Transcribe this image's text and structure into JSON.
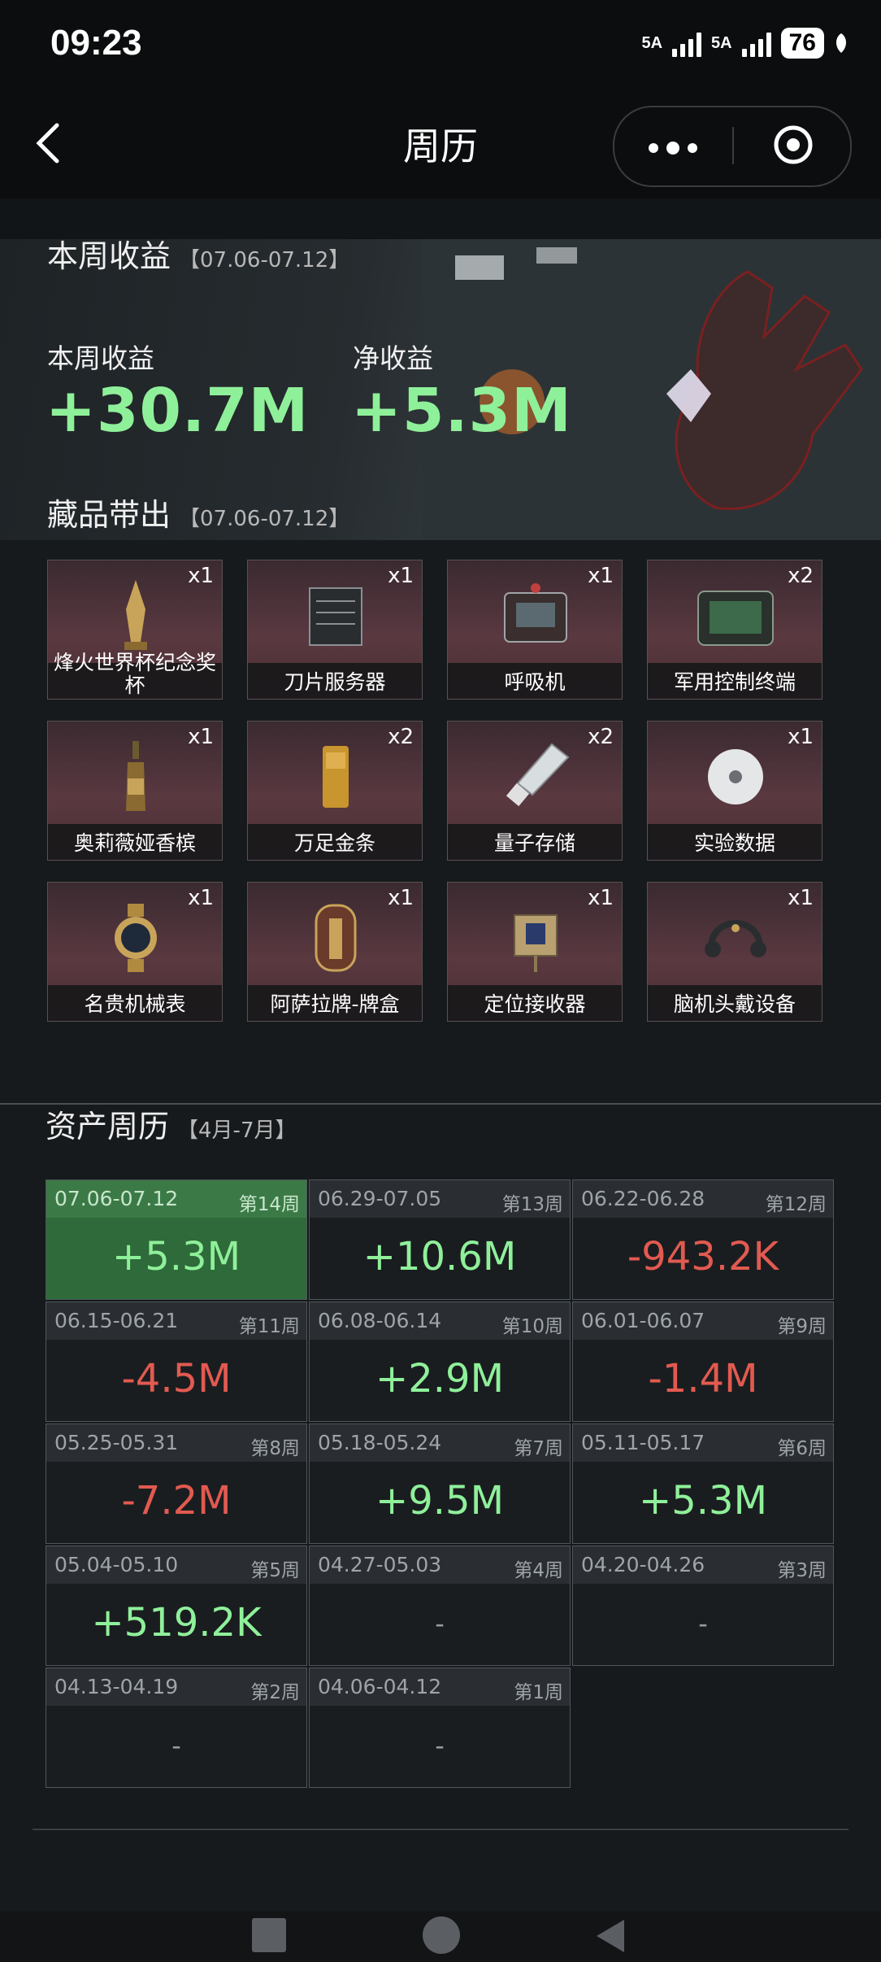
{
  "status_bar": {
    "time": "09:23",
    "net1": "5A",
    "net2": "5A",
    "battery": "76"
  },
  "nav": {
    "title": "周历"
  },
  "weekly": {
    "section_title": "本周收益",
    "range": "【07.06-07.12】",
    "income_label": "本周收益",
    "income_value": "+30.7M",
    "net_label": "净收益",
    "net_value": "+5.3M"
  },
  "collectibles": {
    "section_title": "藏品带出",
    "range": "【07.06-07.12】",
    "items": [
      {
        "name": "烽火世界杯纪念奖杯",
        "qty": "x1",
        "icon": "trophy-icon"
      },
      {
        "name": "刀片服务器",
        "qty": "x1",
        "icon": "server-icon"
      },
      {
        "name": "呼吸机",
        "qty": "x1",
        "icon": "ventilator-icon"
      },
      {
        "name": "军用控制终端",
        "qty": "x2",
        "icon": "terminal-icon"
      },
      {
        "name": "奥莉薇娅香槟",
        "qty": "x1",
        "icon": "champagne-icon"
      },
      {
        "name": "万足金条",
        "qty": "x2",
        "icon": "gold-bar-icon"
      },
      {
        "name": "量子存储",
        "qty": "x2",
        "icon": "usb-drive-icon"
      },
      {
        "name": "实验数据",
        "qty": "x1",
        "icon": "disc-icon"
      },
      {
        "name": "名贵机械表",
        "qty": "x1",
        "icon": "watch-icon"
      },
      {
        "name": "阿萨拉牌-牌盒",
        "qty": "x1",
        "icon": "card-box-icon"
      },
      {
        "name": "定位接收器",
        "qty": "x1",
        "icon": "receiver-icon"
      },
      {
        "name": "脑机头戴设备",
        "qty": "x1",
        "icon": "headset-icon"
      }
    ]
  },
  "calendar": {
    "section_title": "资产周历",
    "range": "【4月-7月】",
    "weeks": [
      {
        "date": "07.06-07.12",
        "week": "第14周",
        "value": "+5.3M",
        "kind": "pos",
        "active": true
      },
      {
        "date": "06.29-07.05",
        "week": "第13周",
        "value": "+10.6M",
        "kind": "pos"
      },
      {
        "date": "06.22-06.28",
        "week": "第12周",
        "value": "-943.2K",
        "kind": "neg"
      },
      {
        "date": "06.15-06.21",
        "week": "第11周",
        "value": "-4.5M",
        "kind": "neg"
      },
      {
        "date": "06.08-06.14",
        "week": "第10周",
        "value": "+2.9M",
        "kind": "pos"
      },
      {
        "date": "06.01-06.07",
        "week": "第9周",
        "value": "-1.4M",
        "kind": "neg"
      },
      {
        "date": "05.25-05.31",
        "week": "第8周",
        "value": "-7.2M",
        "kind": "neg"
      },
      {
        "date": "05.18-05.24",
        "week": "第7周",
        "value": "+9.5M",
        "kind": "pos"
      },
      {
        "date": "05.11-05.17",
        "week": "第6周",
        "value": "+5.3M",
        "kind": "pos"
      },
      {
        "date": "05.04-05.10",
        "week": "第5周",
        "value": "+519.2K",
        "kind": "pos"
      },
      {
        "date": "04.27-05.03",
        "week": "第4周",
        "value": "-",
        "kind": "none"
      },
      {
        "date": "04.20-04.26",
        "week": "第3周",
        "value": "-",
        "kind": "none"
      },
      {
        "date": "04.13-04.19",
        "week": "第2周",
        "value": "-",
        "kind": "none"
      },
      {
        "date": "04.06-04.12",
        "week": "第1周",
        "value": "-",
        "kind": "none"
      }
    ]
  },
  "colors": {
    "positive": "#8ff09a",
    "negative": "#e25a50",
    "active_cell": "#2f6a3a"
  }
}
